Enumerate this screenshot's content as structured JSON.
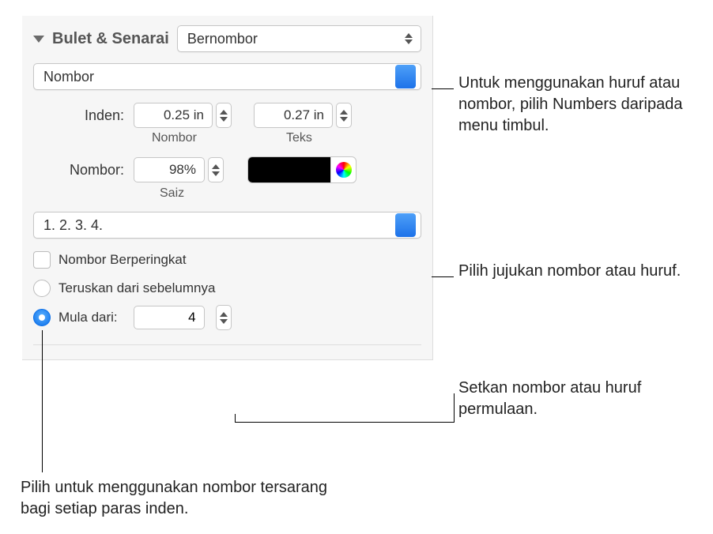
{
  "section": {
    "title": "Bulet & Senarai",
    "style_popup": "Bernombor"
  },
  "type_popup": "Nombor",
  "indent": {
    "label": "Inden:",
    "number_value": "0.25 in",
    "number_sublabel": "Nombor",
    "text_value": "0.27 in",
    "text_sublabel": "Teks"
  },
  "size": {
    "label": "Nombor:",
    "value": "98%",
    "sublabel": "Saiz"
  },
  "color": "#000000",
  "sequence_popup": "1. 2. 3. 4.",
  "tiered_checkbox": {
    "label": "Nombor Berperingkat",
    "checked": false
  },
  "radio": {
    "continue_label": "Teruskan dari sebelumnya",
    "start_label": "Mula dari:",
    "start_value": "4",
    "selected": "start"
  },
  "callouts": {
    "type": "Untuk menggunakan huruf atau nombor, pilih Numbers daripada menu timbul.",
    "sequence": "Pilih jujukan nombor atau huruf.",
    "start": "Setkan nombor atau huruf permulaan.",
    "tiered": "Pilih untuk menggunakan nombor tersarang bagi setiap paras inden."
  }
}
